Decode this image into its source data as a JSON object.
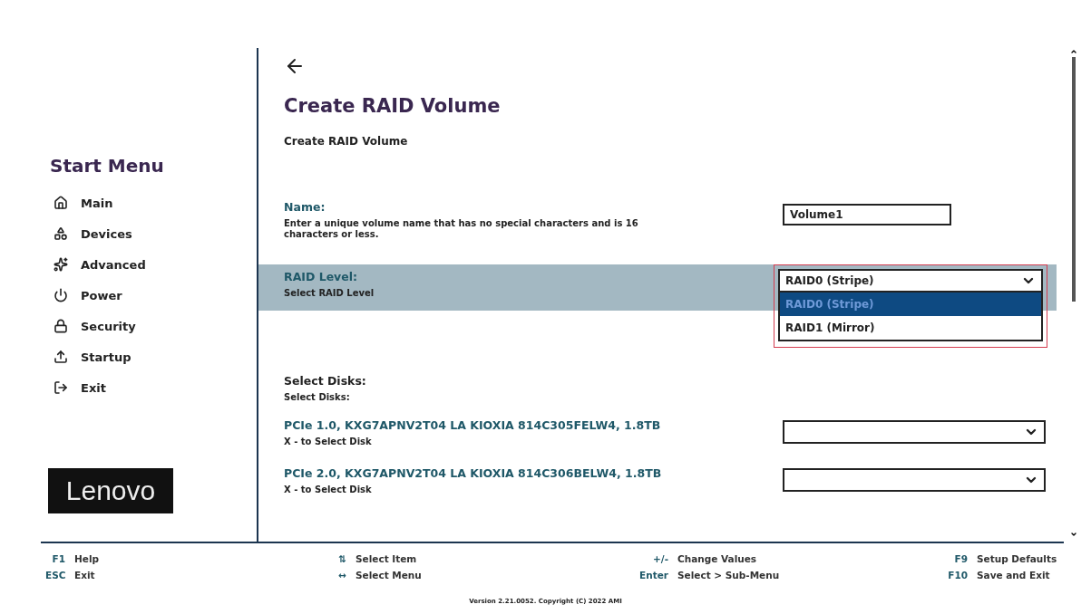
{
  "sidebar": {
    "title": "Start Menu",
    "items": [
      {
        "label": "Main",
        "selected": false
      },
      {
        "label": "Devices",
        "selected": false
      },
      {
        "label": "Advanced",
        "selected": false
      },
      {
        "label": "Power",
        "selected": false
      },
      {
        "label": "Security",
        "selected": false
      },
      {
        "label": "Startup",
        "selected": false
      },
      {
        "label": "Exit",
        "selected": false
      }
    ],
    "logo": "Lenovo"
  },
  "page": {
    "title": "Create RAID Volume",
    "subtitle": "Create RAID Volume",
    "settings": [
      {
        "kind": "text",
        "label": "Name:",
        "help": "Enter a unique volume name that has no special characters and is 16 characters or less.",
        "value": "Volume1",
        "selected": false
      },
      {
        "kind": "select",
        "label": "RAID Level:",
        "help": "Select RAID Level",
        "value": "RAID0 (Stripe)",
        "selected": true,
        "expanded": true,
        "options": [
          {
            "label": "RAID0 (Stripe)",
            "selected": true
          },
          {
            "label": "RAID1 (Mirror)",
            "selected": false
          }
        ]
      },
      {
        "kind": "heading",
        "label": "Select Disks:",
        "help": "Select Disks:",
        "selected": false
      },
      {
        "kind": "select",
        "label": "PCIe 1.0, KXG7APNV2T04 LA KIOXIA 814C305FELW4, 1.8TB",
        "help": "X - to Select Disk",
        "selected": false,
        "expanded": false
      },
      {
        "kind": "select",
        "label": "PCIe 2.0, KXG7APNV2T04 LA KIOXIA 814C306BELW4, 1.8TB",
        "help": "X - to Select Disk",
        "selected": false,
        "expanded": false
      }
    ]
  },
  "footer": {
    "keys": [
      [
        {
          "key": "F1",
          "action": "Help"
        },
        {
          "key": "ESC",
          "action": "Exit"
        }
      ],
      [
        {
          "key": "⇅",
          "action": "Select Item"
        },
        {
          "key": "↔",
          "action": "Select Menu"
        }
      ],
      [
        {
          "key": "+/-",
          "action": "Change Values"
        },
        {
          "key": "Enter",
          "action": "Select > Sub-Menu"
        }
      ],
      [
        {
          "key": "F9",
          "action": "Setup Defaults"
        },
        {
          "key": "F10",
          "action": "Save and Exit"
        }
      ]
    ],
    "version": "Version 2.21.0052. Copyright (C) 2022 AMI"
  }
}
